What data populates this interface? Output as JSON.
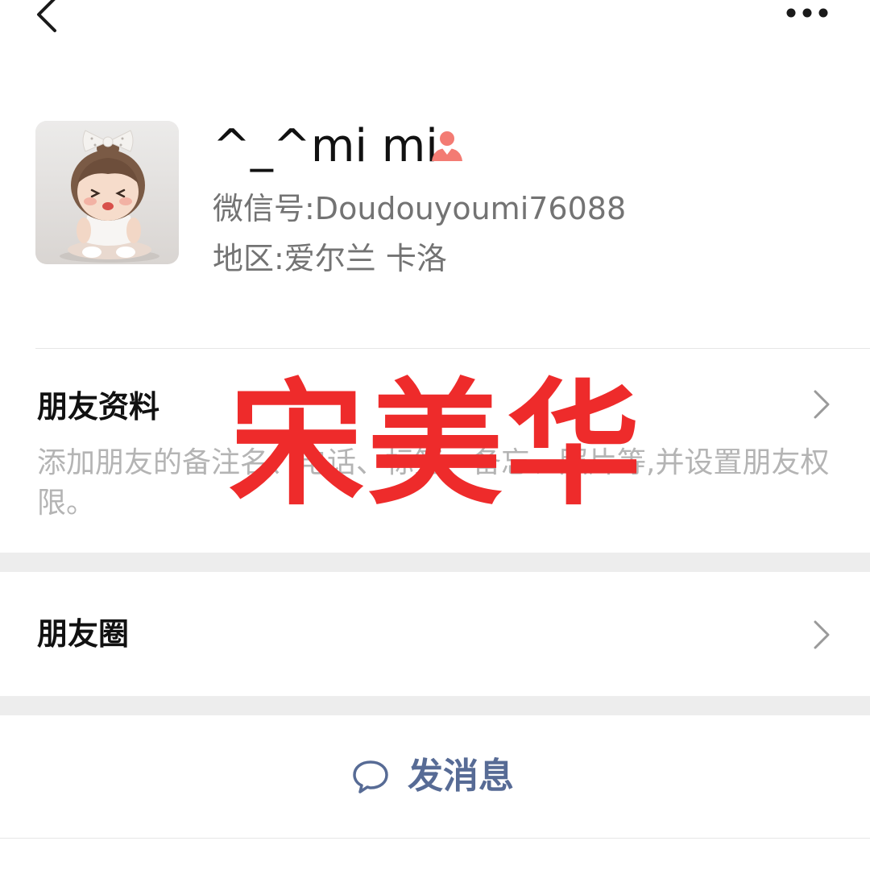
{
  "topbar": {
    "back_icon": "chevron-left-icon",
    "more_icon": "more-horizontal-icon"
  },
  "profile": {
    "nickname": "^_^mi mi",
    "gender_icon": "female-person-icon",
    "gender_color": "#f37b73",
    "wechat_id_label": "微信号:Doudouyoumi76088",
    "region_label": "地区:爱尔兰 卡洛"
  },
  "friend_info": {
    "title": "朋友资料",
    "description": "添加朋友的备注名、电话、标签、备忘、照片等,并设置朋友权限。"
  },
  "moments": {
    "title": "朋友圈"
  },
  "send_message": {
    "label": "发消息",
    "icon": "chat-bubble-icon",
    "color": "#576b95"
  },
  "watermark": {
    "text": "宋美华",
    "color": "#ee2b2b"
  }
}
